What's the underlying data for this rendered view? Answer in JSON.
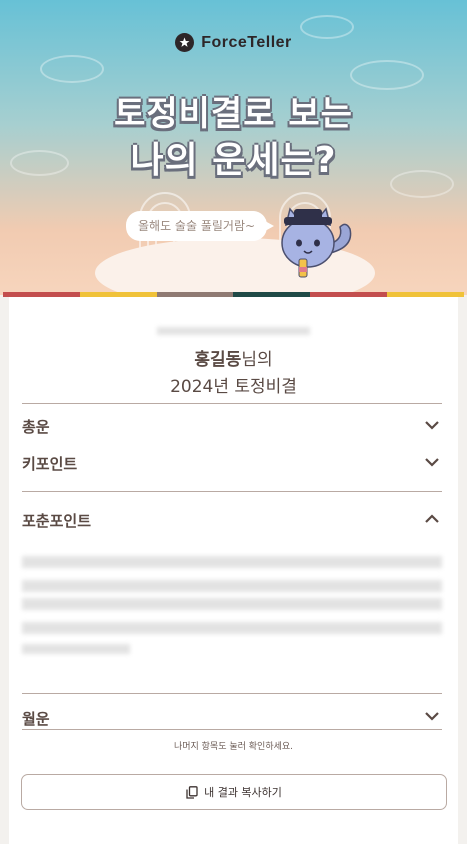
{
  "logo": {
    "text": "ForceTeller",
    "icon": "star-circle-icon"
  },
  "hero": {
    "title_line1": "토정비결로 보는",
    "title_line2": "나의 운세는?",
    "bubble": "올해도 술술 풀릴거람~",
    "mascot": "cat-mascot"
  },
  "stripe_colors": [
    "#c34e4e",
    "#f0c239",
    "#8f7a73",
    "#1f4a47",
    "#c34e4e",
    "#f0c239"
  ],
  "result": {
    "name": "홍길동",
    "name_suffix": "님의",
    "year_title": "2024년 토정비결"
  },
  "sections": [
    {
      "label": "총운",
      "expanded": false
    },
    {
      "label": "키포인트",
      "expanded": false
    },
    {
      "label": "포춘포인트",
      "expanded": true
    },
    {
      "label": "월운",
      "expanded": false
    }
  ],
  "hint": "나머지 항목도 눌러 확인하세요.",
  "copy_button": {
    "label": "내 결과 복사하기",
    "icon": "copy-icon"
  },
  "colors": {
    "text": "#5a4a44",
    "divider": "#b9aaa3"
  }
}
